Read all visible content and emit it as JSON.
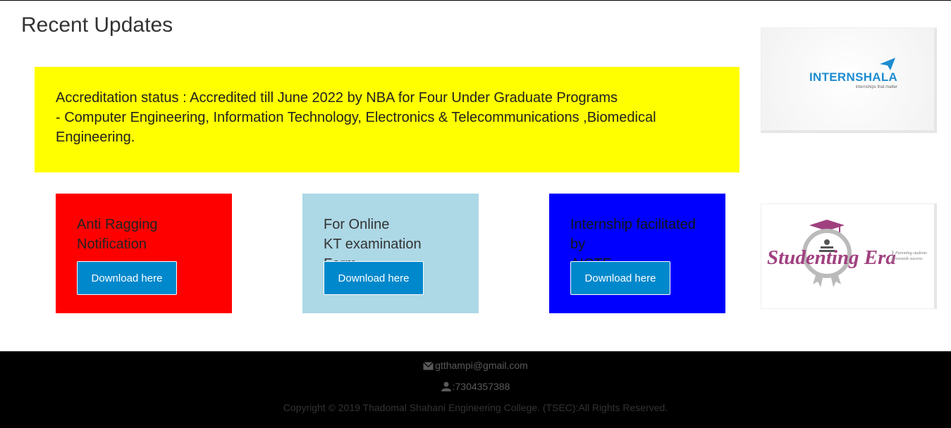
{
  "section": {
    "title": "Recent Updates"
  },
  "banner": {
    "line1": "Accreditation status : Accredited till June 2022 by NBA for Four Under Graduate Programs",
    "line2": "- Computer Engineering, Information Technology, Electronics & Telecommunications ,Biomedical Engineering.",
    "background": "#ffff00"
  },
  "cards": [
    {
      "line1": "Anti Ragging",
      "line2": "Notification",
      "button": "Download here",
      "background": "#ff0000"
    },
    {
      "line1": "For Online",
      "line2": "KT examination Form",
      "button": "Download here",
      "background": "#add8e6"
    },
    {
      "line1": "Internship facilitated by",
      "line2": "AICTE",
      "button": "Download here",
      "background": "#0000ff"
    }
  ],
  "ads": {
    "internshala": {
      "name": "INTERNSHALA",
      "tagline": "internships that matter",
      "icon": "paper-plane-icon"
    },
    "studenting_era": {
      "name": "Studenting Era",
      "tagline": "Parenting students towards success",
      "icon": "graduate-badge-icon"
    }
  },
  "footer": {
    "email": "gtthampi@gmail.com",
    "email_icon": "envelope-icon",
    "phone": ":7304357388",
    "phone_icon": "user-icon",
    "copyright": "Copyright © 2019 Thadomal Shahani Engineering College. (TSEC):All Rights Reserved."
  },
  "colors": {
    "button": "#0088cc",
    "footer_bg": "#000000"
  }
}
